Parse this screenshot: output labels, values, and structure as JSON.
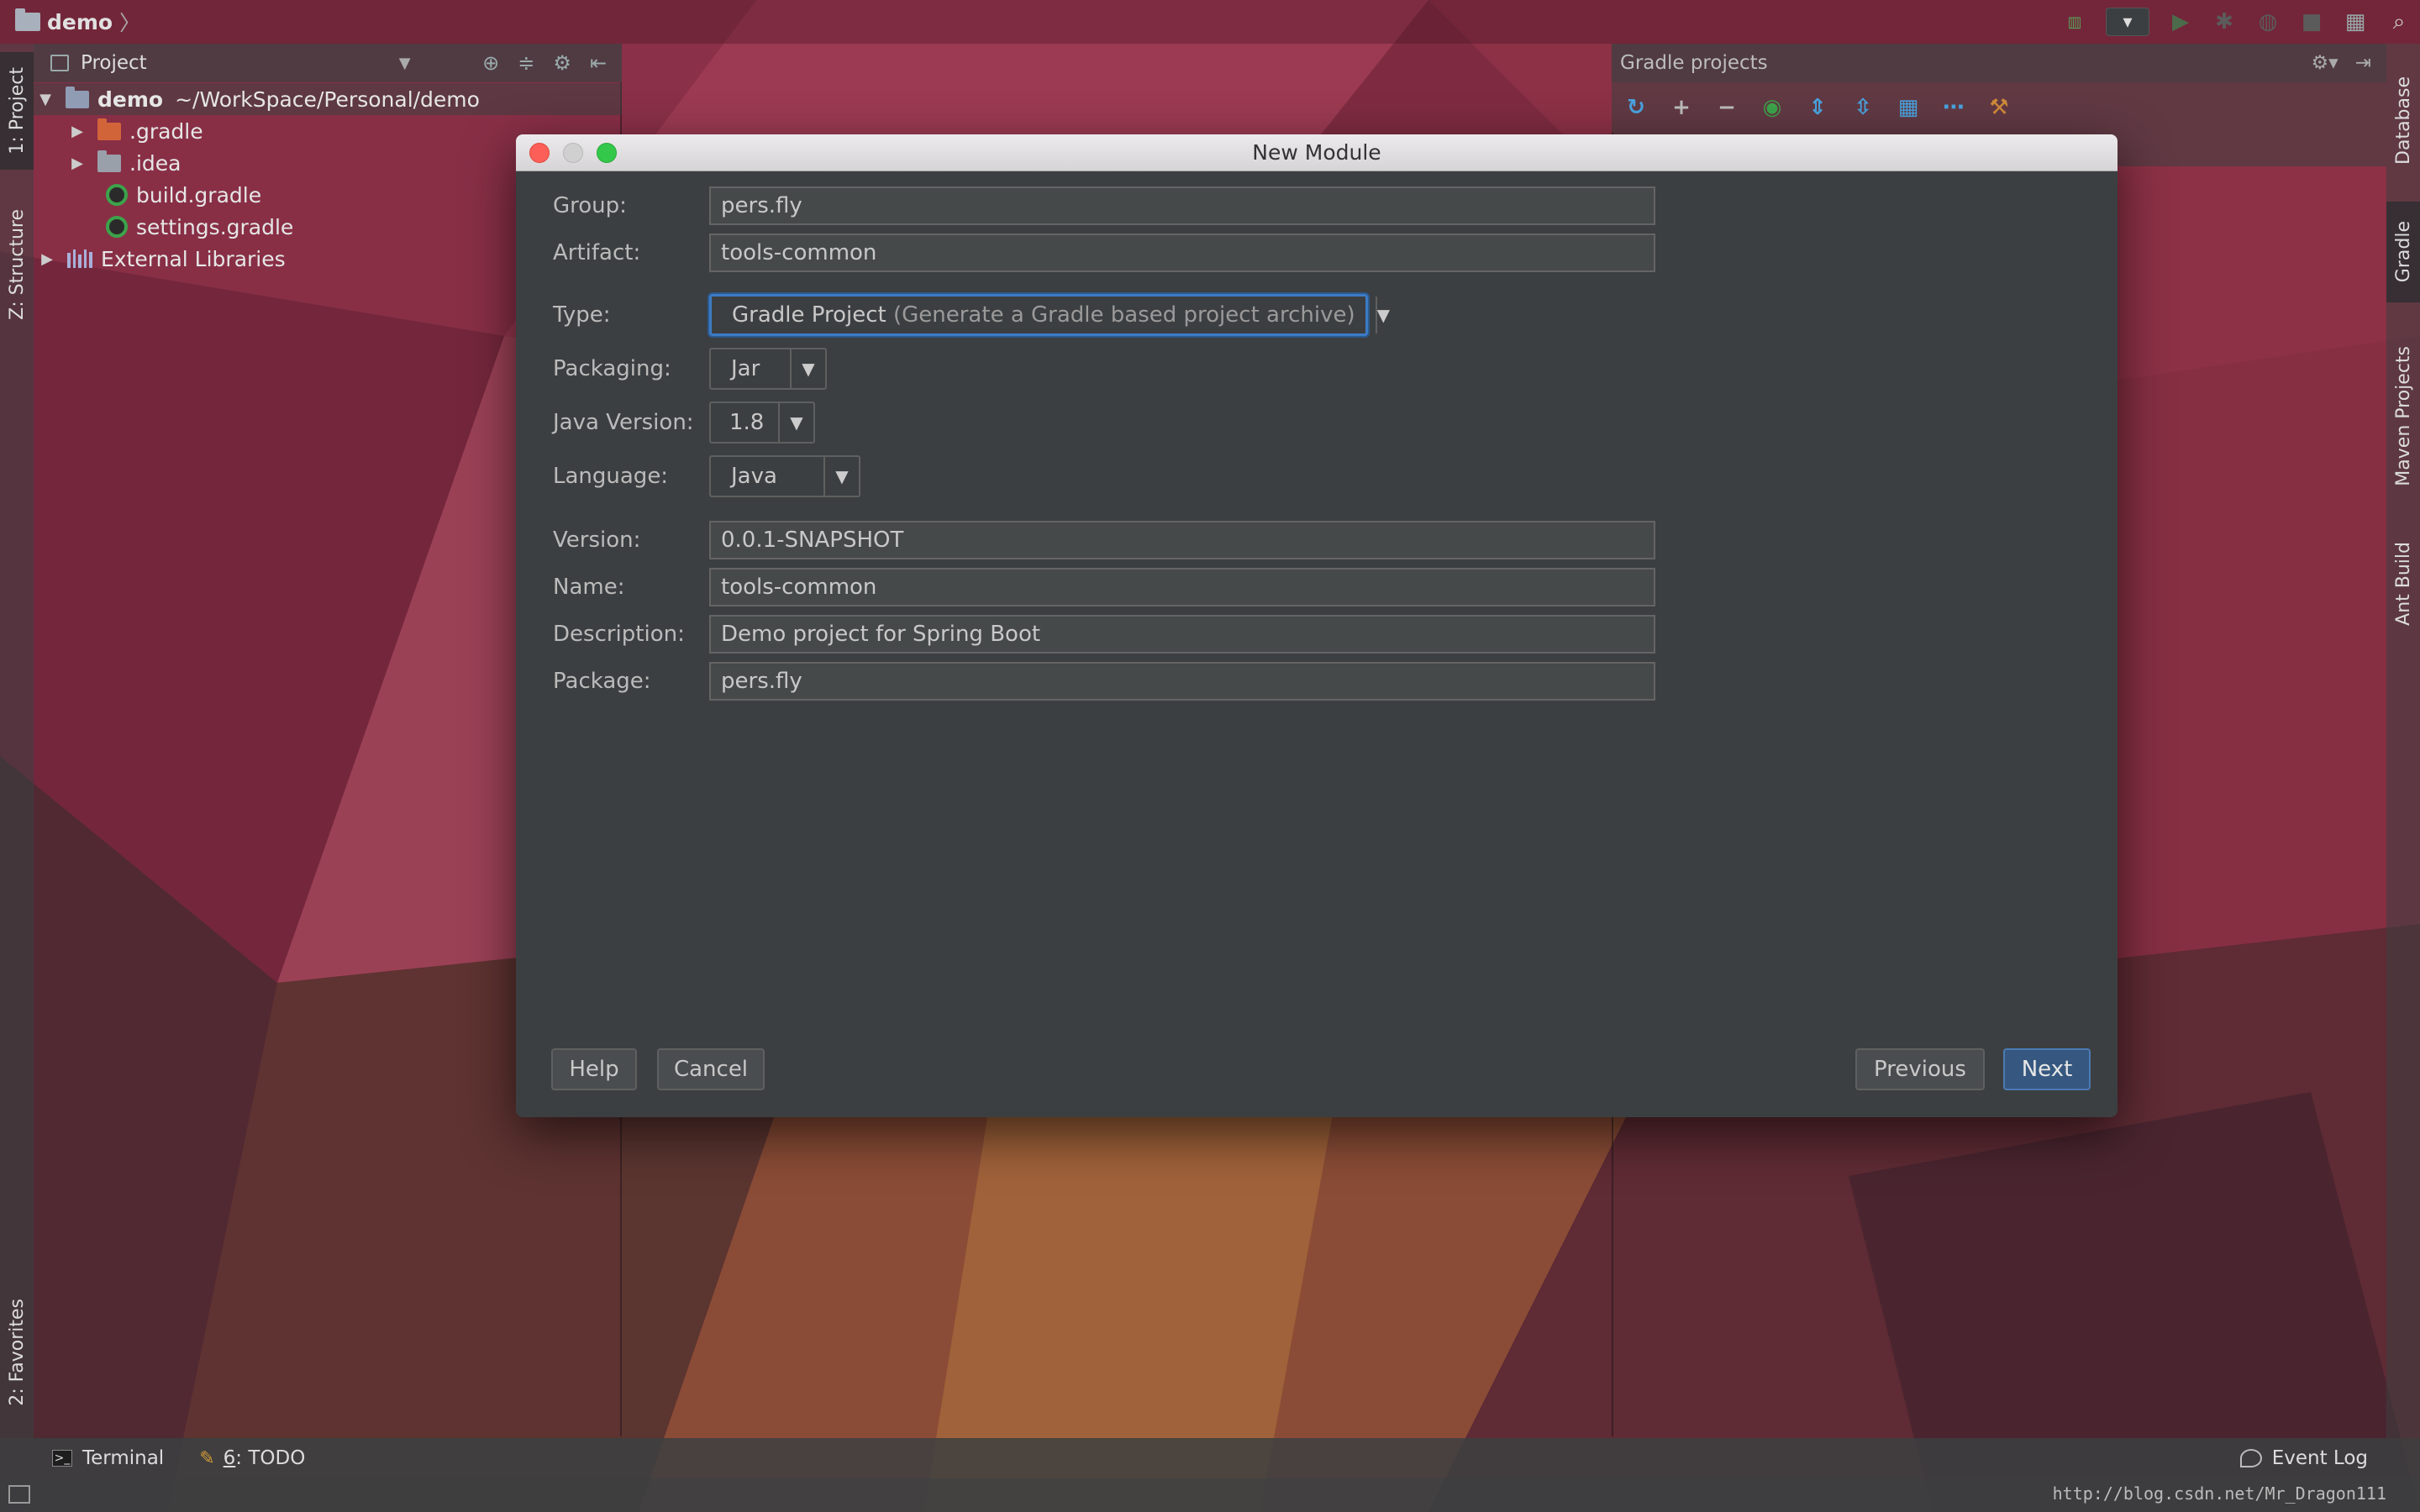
{
  "navbar": {
    "project_name": "demo"
  },
  "left_stripe": {
    "tab_project": "1: Project",
    "tab_structure": "Z: Structure",
    "tab_favorites": "2: Favorites"
  },
  "right_stripe": {
    "tab_database": "Database",
    "tab_gradle": "Gradle",
    "tab_maven": "Maven Projects",
    "tab_ant": "Ant Build"
  },
  "project_panel": {
    "title": "Project",
    "tree": [
      {
        "name": "demo",
        "path": "~/WorkSpace/Personal/demo",
        "kind": "module-folder",
        "expanded": true
      },
      {
        "name": ".gradle",
        "kind": "folder-orange",
        "expanded": false
      },
      {
        "name": ".idea",
        "kind": "folder",
        "expanded": false
      },
      {
        "name": "build.gradle",
        "kind": "gradle-file"
      },
      {
        "name": "settings.gradle",
        "kind": "gradle-file"
      },
      {
        "name": "External Libraries",
        "kind": "library",
        "expanded": false
      }
    ]
  },
  "gradle_panel": {
    "title": "Gradle projects"
  },
  "dialog": {
    "title": "New Module",
    "fields": {
      "group_label": "Group:",
      "group_value": "pers.fly",
      "artifact_label": "Artifact:",
      "artifact_value": "tools-common",
      "type_label": "Type:",
      "type_value": "Gradle Project",
      "type_hint": "(Generate a Gradle based project archive)",
      "packaging_label": "Packaging:",
      "packaging_value": "Jar",
      "java_version_label": "Java Version:",
      "java_version_value": "1.8",
      "language_label": "Language:",
      "language_value": "Java",
      "version_label": "Version:",
      "version_value": "0.0.1-SNAPSHOT",
      "name_label": "Name:",
      "name_value": "tools-common",
      "description_label": "Description:",
      "description_value": "Demo project for Spring Boot",
      "package_label": "Package:",
      "package_value": "pers.fly"
    },
    "buttons": {
      "help": "Help",
      "cancel": "Cancel",
      "previous": "Previous",
      "next": "Next"
    }
  },
  "bottom_bar": {
    "terminal": "Terminal",
    "todo_num": "6",
    "todo_label": ": TODO",
    "event_log": "Event Log"
  },
  "watermark": "http://blog.csdn.net/Mr_Dragon111",
  "colors": {
    "dialog_bg": "#3c3f41",
    "field_bg": "#45494a",
    "focus_blue": "#3d7bc4",
    "primary_button": "#365880",
    "gradle_green": "#3ca34a"
  }
}
